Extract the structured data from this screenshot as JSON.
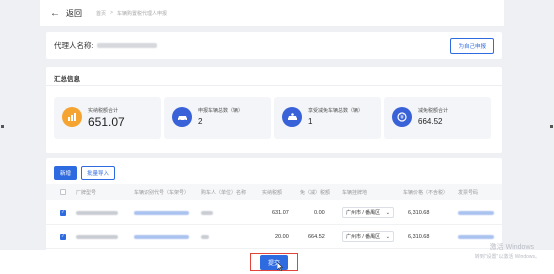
{
  "header": {
    "back_label": "返回",
    "breadcrumb": [
      "首页",
      ">",
      "车辆购置税代理人申报"
    ]
  },
  "agent": {
    "label": "代理人名称:",
    "action_button": "为自己申报"
  },
  "summary": {
    "title": "汇总信息",
    "stats": [
      {
        "label": "实纳税额合计",
        "value": "651.07",
        "icon": "bar-chart-icon",
        "color": "#f5a431"
      },
      {
        "label": "申报车辆总数（辆）",
        "value": "2",
        "icon": "car-icon",
        "color": "#3a62d8"
      },
      {
        "label": "享受减免车辆总数（辆）",
        "value": "1",
        "icon": "car-discount-icon",
        "color": "#3a62d8"
      },
      {
        "label": "减免税额合计",
        "value": "664.52",
        "icon": "tax-relief-icon",
        "color": "#3a62d8"
      }
    ]
  },
  "table": {
    "add_button": "新增",
    "import_button": "批量导入",
    "columns": [
      "厂牌型号",
      "车辆识别代号（车架号）",
      "购车人（单位）名称",
      "实纳税额",
      "免（减）税额",
      "车辆挂牌地",
      "车辆价格（不含税）",
      "发票号码"
    ],
    "rows": [
      {
        "paid_tax": "631.07",
        "exempt_tax": "0.00",
        "plate_location": "广州市 / 番禺区",
        "price": "6,310.68"
      },
      {
        "paid_tax": "20.00",
        "exempt_tax": "664.52",
        "plate_location": "广州市 / 番禺区",
        "price": "6,310.68"
      }
    ]
  },
  "footer": {
    "submit_label": "提交"
  },
  "watermark": {
    "title": "激活 Windows",
    "subtitle": "转到\"设置\"以激活 Windows。"
  },
  "colors": {
    "primary": "#2f6be0",
    "highlight_border": "#e0443a"
  }
}
